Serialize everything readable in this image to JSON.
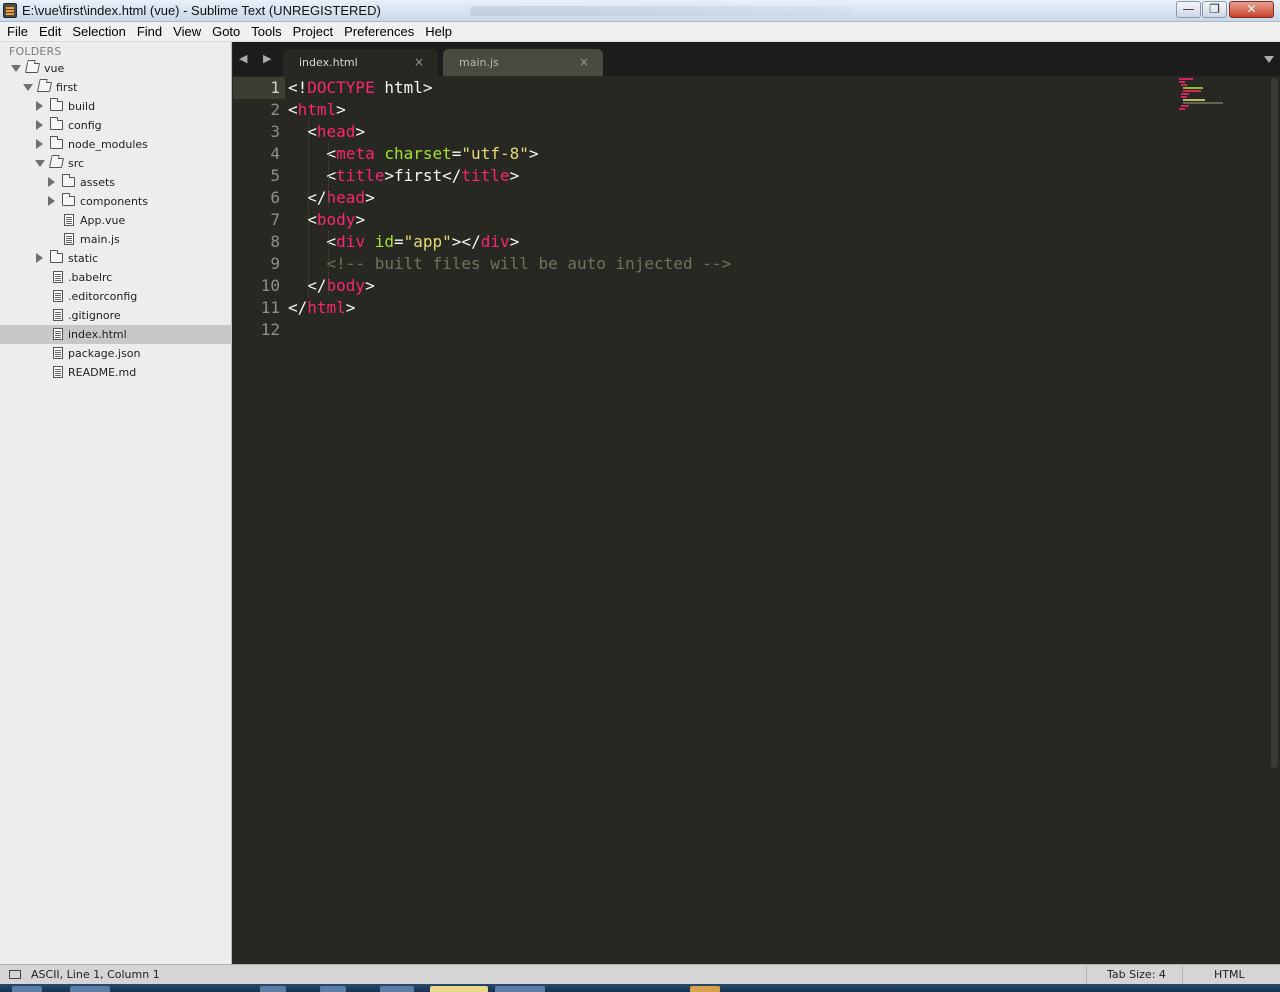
{
  "window": {
    "title": "E:\\vue\\first\\index.html (vue) - Sublime Text (UNREGISTERED)",
    "min_glyph": "—",
    "max_glyph": "❐",
    "close_glyph": "✕"
  },
  "menu": [
    "File",
    "Edit",
    "Selection",
    "Find",
    "View",
    "Goto",
    "Tools",
    "Project",
    "Preferences",
    "Help"
  ],
  "sidebar": {
    "header": "FOLDERS",
    "items": [
      {
        "label": "vue",
        "type": "folder",
        "state": "open",
        "depth": 0
      },
      {
        "label": "first",
        "type": "folder",
        "state": "open",
        "depth": 1
      },
      {
        "label": "build",
        "type": "folder",
        "state": "closed",
        "depth": 2
      },
      {
        "label": "config",
        "type": "folder",
        "state": "closed",
        "depth": 2
      },
      {
        "label": "node_modules",
        "type": "folder",
        "state": "closed",
        "depth": 2
      },
      {
        "label": "src",
        "type": "folder",
        "state": "open",
        "depth": 2
      },
      {
        "label": "assets",
        "type": "folder",
        "state": "closed",
        "depth": 3
      },
      {
        "label": "components",
        "type": "folder",
        "state": "closed",
        "depth": 3
      },
      {
        "label": "App.vue",
        "type": "file",
        "depth": 3
      },
      {
        "label": "main.js",
        "type": "file",
        "depth": 3
      },
      {
        "label": "static",
        "type": "folder",
        "state": "closed",
        "depth": 2
      },
      {
        "label": ".babelrc",
        "type": "file",
        "depth": 2
      },
      {
        "label": ".editorconfig",
        "type": "file",
        "depth": 2
      },
      {
        "label": ".gitignore",
        "type": "file",
        "depth": 2
      },
      {
        "label": "index.html",
        "type": "file",
        "depth": 2,
        "selected": true
      },
      {
        "label": "package.json",
        "type": "file",
        "depth": 2
      },
      {
        "label": "README.md",
        "type": "file",
        "depth": 2
      }
    ]
  },
  "tabs": {
    "nav": "◀ ▶",
    "items": [
      {
        "label": "index.html",
        "close": "×",
        "active": true
      },
      {
        "label": "main.js",
        "close": "×",
        "active": false
      }
    ]
  },
  "editor": {
    "line_numbers": [
      "1",
      "2",
      "3",
      "4",
      "5",
      "6",
      "7",
      "8",
      "9",
      "10",
      "11",
      "12"
    ],
    "lines": [
      [
        [
          "p",
          "<!"
        ],
        [
          "tag",
          "DOCTYPE"
        ],
        [
          "p",
          " html>"
        ]
      ],
      [
        [
          "p",
          "<"
        ],
        [
          "tag",
          "html"
        ],
        [
          "p",
          ">"
        ]
      ],
      [
        [
          "p",
          "  <"
        ],
        [
          "tag",
          "head"
        ],
        [
          "p",
          ">"
        ]
      ],
      [
        [
          "p",
          "    <"
        ],
        [
          "tag",
          "meta"
        ],
        [
          "p",
          " "
        ],
        [
          "attr",
          "charset"
        ],
        [
          "p",
          "="
        ],
        [
          "str",
          "\"utf-8\""
        ],
        [
          "p",
          ">"
        ]
      ],
      [
        [
          "p",
          "    <"
        ],
        [
          "tag",
          "title"
        ],
        [
          "p",
          ">first</"
        ],
        [
          "tag",
          "title"
        ],
        [
          "p",
          ">"
        ]
      ],
      [
        [
          "p",
          "  </"
        ],
        [
          "tag",
          "head"
        ],
        [
          "p",
          ">"
        ]
      ],
      [
        [
          "p",
          "  <"
        ],
        [
          "tag",
          "body"
        ],
        [
          "p",
          ">"
        ]
      ],
      [
        [
          "p",
          "    <"
        ],
        [
          "tag",
          "div"
        ],
        [
          "p",
          " "
        ],
        [
          "attr",
          "id"
        ],
        [
          "p",
          "="
        ],
        [
          "str",
          "\"app\""
        ],
        [
          "p",
          "></"
        ],
        [
          "tag",
          "div"
        ],
        [
          "p",
          ">"
        ]
      ],
      [
        [
          "p",
          "    "
        ],
        [
          "com",
          "<!-- built files will be auto injected -->"
        ]
      ],
      [
        [
          "p",
          "  </"
        ],
        [
          "tag",
          "body"
        ],
        [
          "p",
          ">"
        ]
      ],
      [
        [
          "p",
          "</"
        ],
        [
          "tag",
          "html"
        ],
        [
          "p",
          ">"
        ]
      ],
      []
    ],
    "colors": {
      "background": "#272822",
      "tag": "#f92672",
      "attr": "#a6e22e",
      "string": "#e6db74",
      "comment": "#75715e",
      "plain": "#f8f8f2"
    }
  },
  "status": {
    "position": "ASCII, Line 1, Column 1",
    "tab_size": "Tab Size: 4",
    "syntax": "HTML"
  }
}
